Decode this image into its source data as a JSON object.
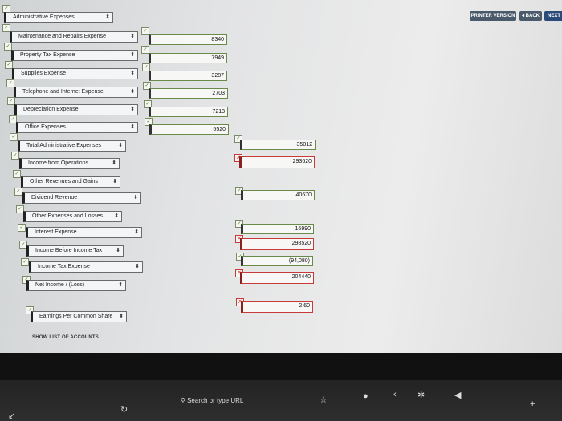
{
  "header": {
    "printer_version": "PRINTER VERSION",
    "back": "◂ BACK",
    "next": "NEXT"
  },
  "rows": [
    {
      "label": "Administrative Expenses"
    },
    {
      "label": "Maintenance and Repairs Expense",
      "amount": "8340"
    },
    {
      "label": "Property Tax Expense",
      "amount": "7949"
    },
    {
      "label": "Supplies Expense",
      "amount": "3287"
    },
    {
      "label": "Telephone and Internet Expense",
      "amount": "2703"
    },
    {
      "label": "Depreciation Expense",
      "amount": "7213"
    },
    {
      "label": "Office Expenses",
      "amount": "5520"
    },
    {
      "label": "Total Administrative Expenses",
      "total": "35012"
    },
    {
      "label": "Income from Operations",
      "total": "293620"
    },
    {
      "label": "Other Revenues and Gains"
    },
    {
      "label": "Dividend Revenue",
      "total": "40670"
    },
    {
      "label": "Other Expenses and Losses"
    },
    {
      "label": "Interest Expense",
      "total": "16990"
    },
    {
      "label": "Income Before Income Tax",
      "total": "298520"
    },
    {
      "label": "Income Tax Expense",
      "total": "(94,080)"
    },
    {
      "label": "Net Income / (Loss)",
      "total": "204440"
    },
    {
      "label": "Earnings Per Common Share",
      "total": "2.60"
    }
  ],
  "footer": {
    "show_list": "SHOW LIST OF ACCOUNTS"
  },
  "touchbar": {
    "search_placeholder": "Search or type URL"
  },
  "colors": {
    "error_border": "#c83a3a",
    "ok_border": "#6a8a4a"
  }
}
